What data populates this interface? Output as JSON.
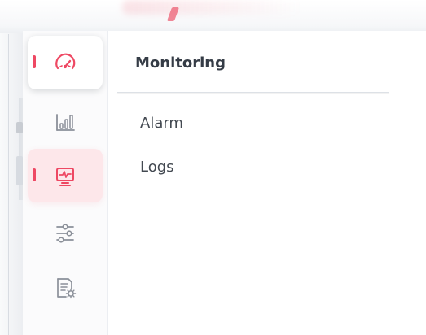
{
  "navigation": {
    "items": [
      {
        "name": "speedometer-icon",
        "state": "selected"
      },
      {
        "name": "bar-chart-icon",
        "state": "normal"
      },
      {
        "name": "monitoring-icon",
        "state": "active"
      },
      {
        "name": "sliders-icon",
        "state": "normal"
      },
      {
        "name": "settings-document-icon",
        "state": "normal"
      }
    ]
  },
  "panel": {
    "title": "Monitoring",
    "items": [
      {
        "label": "Alarm"
      },
      {
        "label": "Logs"
      }
    ]
  },
  "colors": {
    "accent": "#ee4863",
    "accent_soft": "#fde7ea",
    "icon_gray": "#8b9099",
    "text_dark": "#353c46",
    "text_body": "#434951",
    "rail_background": "#fbfbfc",
    "panel_background": "#ffffff"
  }
}
